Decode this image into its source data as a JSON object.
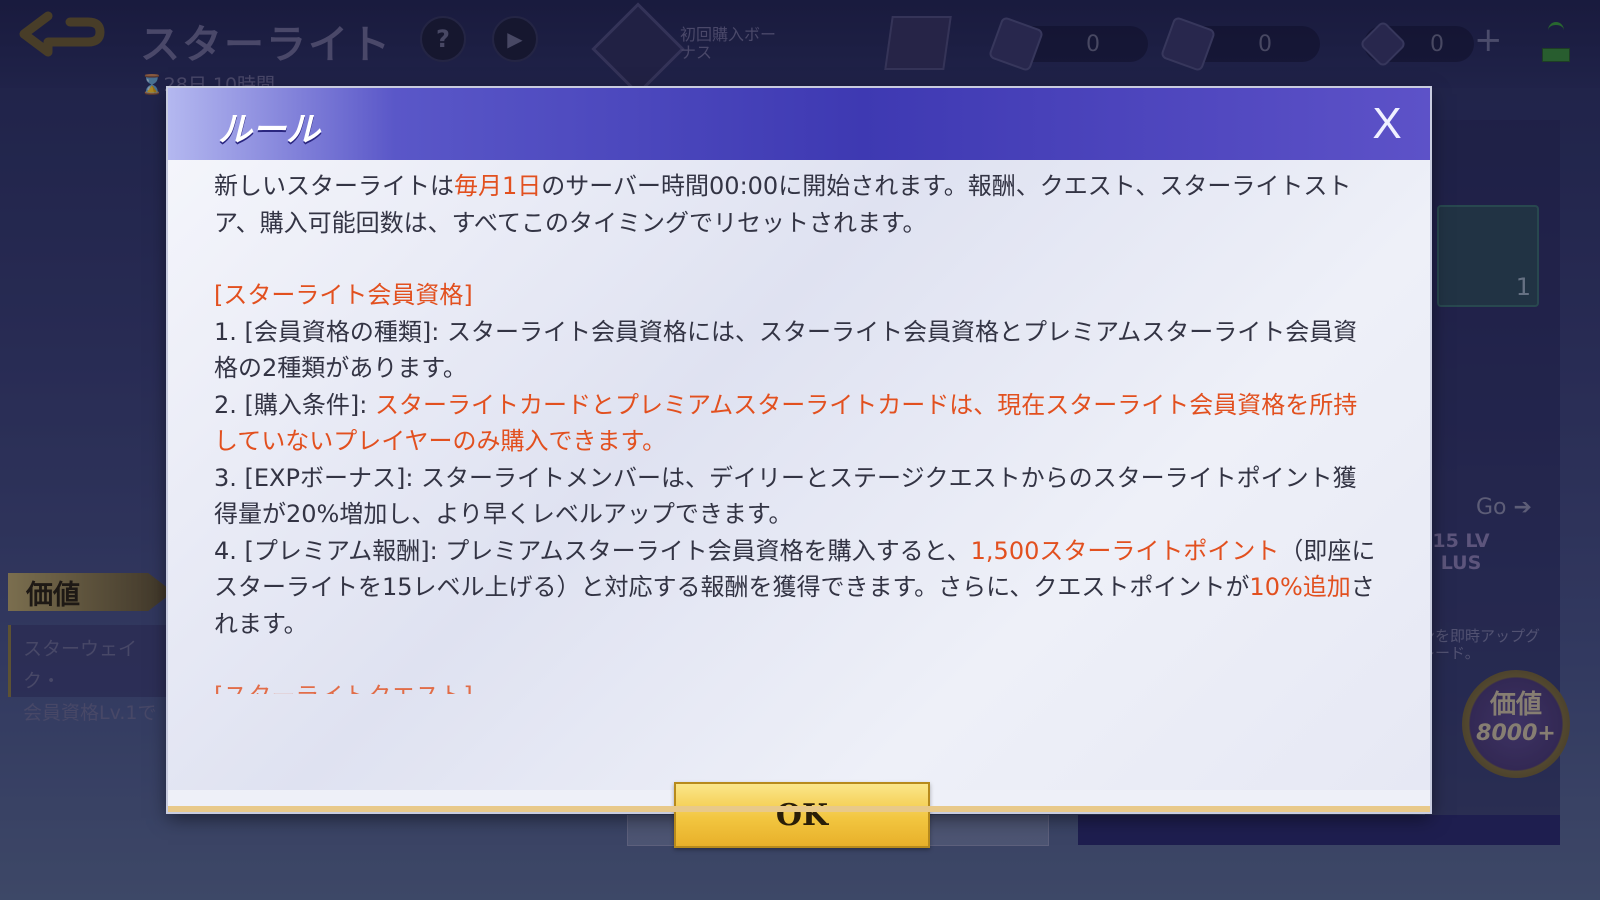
{
  "header": {
    "back_icon": "back-arrow-icon",
    "title": "スターライト",
    "timer": "⌛28日 10時間",
    "help_label": "?",
    "play_label": "▶",
    "first_purchase_bonus": "初回購入ボーナス",
    "currencies": [
      {
        "icon": "starlight-card-icon",
        "value": "0"
      },
      {
        "icon": "premium-card-icon",
        "value": "0"
      },
      {
        "icon": "diamond-icon",
        "value": "0"
      }
    ],
    "add_label": "+"
  },
  "background": {
    "value_tag": "価値",
    "left_card_line1": "スターウェイク・",
    "left_card_line2": "会員資格Lv.1で",
    "potion_quantity": "1",
    "go_label": "Go",
    "plus_badge": "15 LV LUS",
    "upgrade_text": "ンを即時アップグレード。",
    "value_seal_label": "価値",
    "value_seal_amount": "8000+"
  },
  "dialog": {
    "title": "ルール",
    "close_label": "X",
    "ok_label": "OK",
    "intro_a": "新しいスターライトは",
    "intro_hl": "毎月1日",
    "intro_b": "のサーバー時間00:00に開始されます。報酬、クエスト、スターライトストア、購入可能回数は、すべてこのタイミングでリセットされます。",
    "section_membership": "[スターライト会員資格]",
    "rule1": "1. [会員資格の種類]: スターライト会員資格には、スターライト会員資格とプレミアムスターライト会員資格の2種類があります。",
    "rule2_a": "2. [購入条件]: ",
    "rule2_hl": "スターライトカードとプレミアムスターライトカードは、現在スターライト会員資格を所持していないプレイヤーのみ購入できます。",
    "rule3": "3. [EXPボーナス]: スターライトメンバーは、デイリーとステージクエストからのスターライトポイント獲得量が20%増加し、より早くレベルアップできます。",
    "rule4_a": "4. [プレミアム報酬]: プレミアムスターライト会員資格を購入すると、",
    "rule4_hl1": "1,500スターライトポイント",
    "rule4_b": "（即座にスターライトを15レベル上げる）と対応する報酬を獲得できます。さらに、クエストポイントが",
    "rule4_hl2": "10%追加",
    "rule4_c": "されます。",
    "section_quest": "[スターライトクエスト]"
  }
}
